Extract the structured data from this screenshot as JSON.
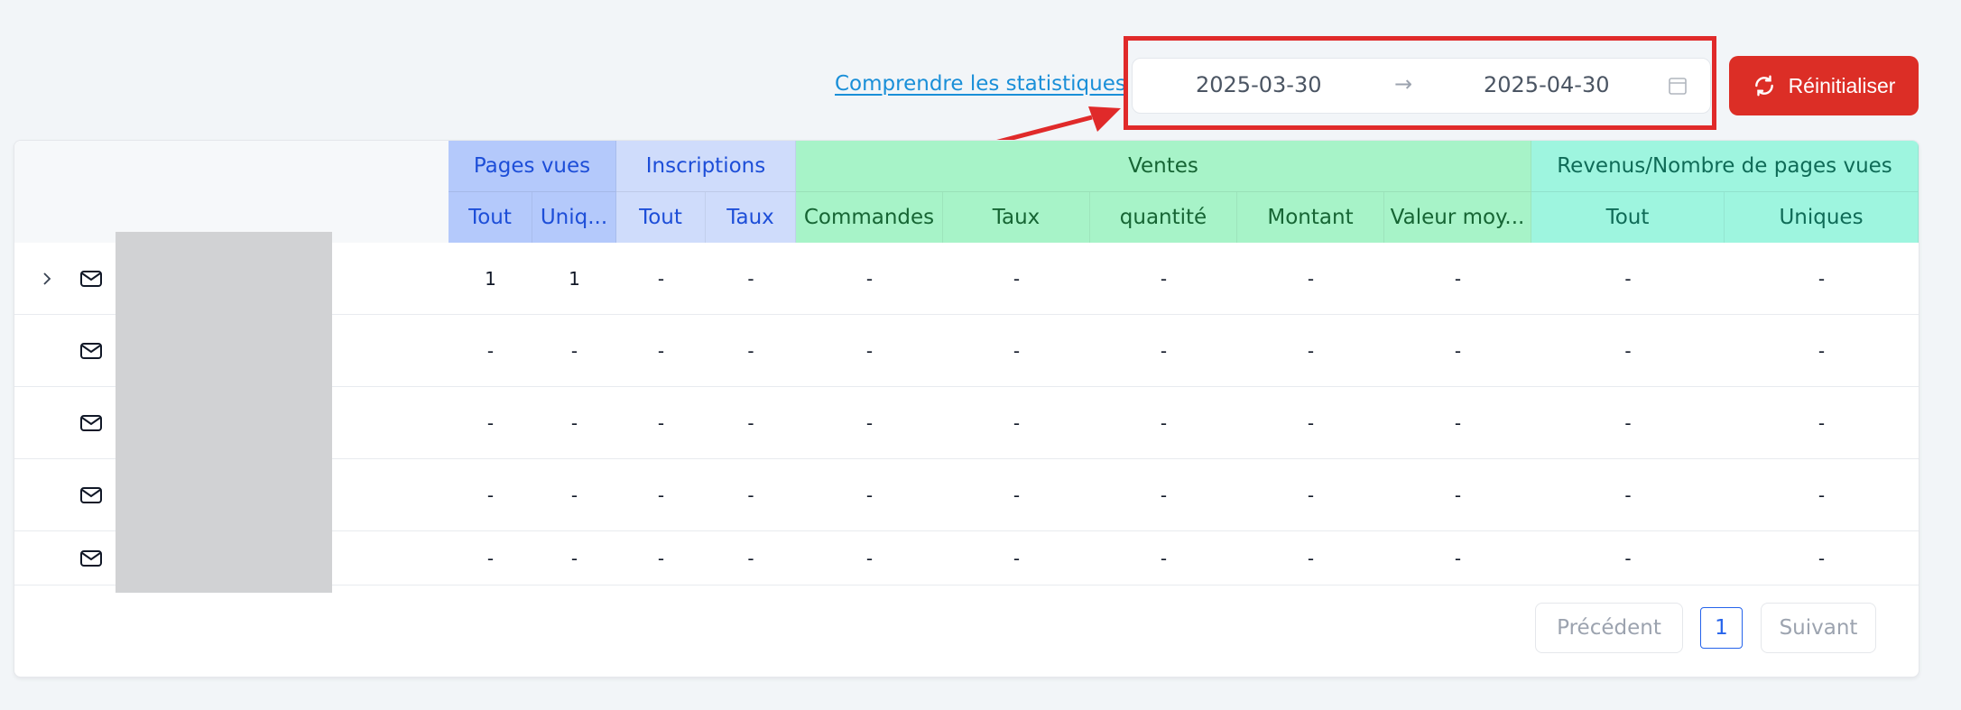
{
  "toolbar": {
    "help_link": "Comprendre les statistiques",
    "date_start": "2025-03-30",
    "date_end": "2025-04-30",
    "arrow": "→",
    "reset_label": "Réinitialiser"
  },
  "table": {
    "groups": [
      {
        "label": "Pages vues",
        "color": "#b4c9fb",
        "text": "#1d4ed8"
      },
      {
        "label": "Inscriptions",
        "color": "#cfdcfb",
        "text": "#1d4ed8"
      },
      {
        "label": "Ventes",
        "color": "#a7f3c8",
        "text": "#166534"
      },
      {
        "label": "Revenus/Nombre de pages vues",
        "color": "#9ef5df",
        "text": "#0f6b57"
      }
    ],
    "columns": [
      "Tout",
      "Uniq...",
      "Tout",
      "Taux",
      "Commandes",
      "Taux",
      "quantité",
      "Montant",
      "Valeur moy...",
      "Tout",
      "Uniques"
    ],
    "rows": [
      {
        "expandable": true,
        "values": [
          "1",
          "1",
          "-",
          "-",
          "-",
          "-",
          "-",
          "-",
          "-",
          "-",
          "-"
        ]
      },
      {
        "expandable": false,
        "values": [
          "-",
          "-",
          "-",
          "-",
          "-",
          "-",
          "-",
          "-",
          "-",
          "-",
          "-"
        ]
      },
      {
        "expandable": false,
        "values": [
          "-",
          "-",
          "-",
          "-",
          "-",
          "-",
          "-",
          "-",
          "-",
          "-",
          "-"
        ]
      },
      {
        "expandable": false,
        "values": [
          "-",
          "-",
          "-",
          "-",
          "-",
          "-",
          "-",
          "-",
          "-",
          "-",
          "-"
        ]
      },
      {
        "expandable": false,
        "values": [
          "-",
          "-",
          "-",
          "-",
          "-",
          "-",
          "-",
          "-",
          "-",
          "-",
          "-"
        ]
      }
    ]
  },
  "pagination": {
    "prev_label": "Précédent",
    "page": "1",
    "next_label": "Suivant"
  },
  "colors": {
    "accent_red": "#dc2e26",
    "link_blue": "#1a8fd8",
    "annotation_red": "#e02a2a"
  }
}
